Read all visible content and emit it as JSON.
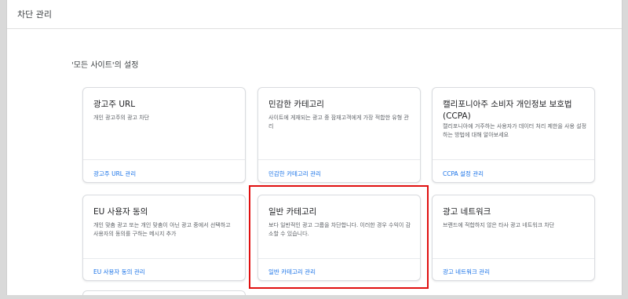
{
  "header": {
    "title": "차단 관리"
  },
  "section": {
    "title": "'모든 사이트'의 설정"
  },
  "cards": [
    {
      "title": "광고주 URL",
      "description": "개인 광고주의 광고 차단",
      "link": "광고주 URL 관리"
    },
    {
      "title": "민감한 카테고리",
      "description": "사이트에 게재되는 광고 중 잠재고객에게 가장 적합한 유형 관리",
      "link": "민감한 카테고리 관리"
    },
    {
      "title": "캘리포니아주 소비자 개인정보 보호법 (CCPA)",
      "description": "캘리포니아에 거주하는 사용자가 데이터 처리 제한을 사용 설정하는 방법에 대해 알아보세요",
      "link": "CCPA 설정 관리"
    },
    {
      "title": "EU 사용자 동의",
      "description": "개인 맞춤 광고 또는 개인 맞춤이 아닌 광고 중에서 선택하고 사용자의 동의를 구하는 메시지 추가",
      "link": "EU 사용자 동의 관리"
    },
    {
      "title": "일반 카테고리",
      "description": "보다 일반적인 광고 그룹을 차단합니다. 이러한 경우 수익이 감소할 수 있습니다.",
      "link": "일반 카테고리 관리"
    },
    {
      "title": "광고 네트워크",
      "description": "브랜드에 적합하지 않은 타사 광고 네트워크 차단",
      "link": "광고 네트워크 관리"
    }
  ],
  "colors": {
    "link": "#1a73e8",
    "highlight": "#e01010",
    "background": "#d9d9d9"
  }
}
